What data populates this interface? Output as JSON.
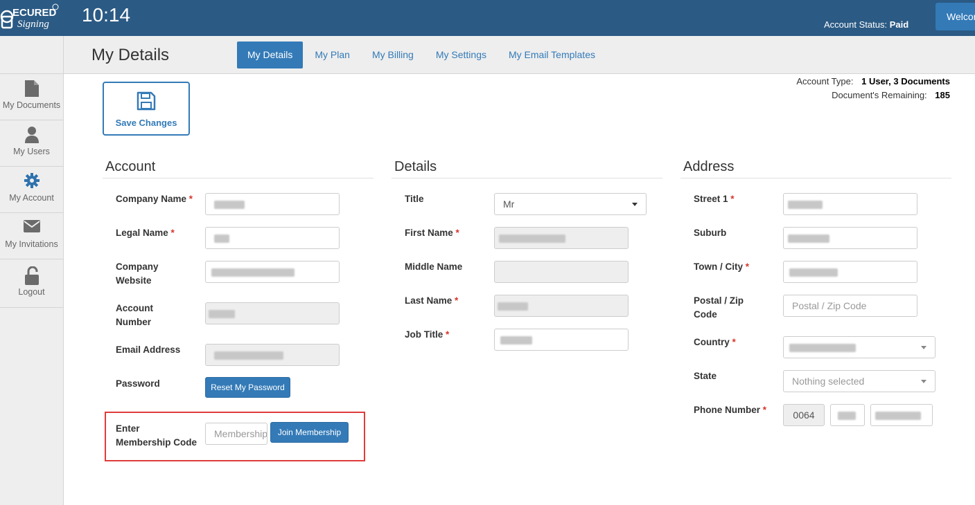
{
  "topbar": {
    "logo_text": "SECURED Signing",
    "clock": "10:14",
    "account_status_label": "Account Status:",
    "account_status_value": "Paid",
    "welcome_label": "Welcome"
  },
  "sidebar": {
    "items": [
      {
        "label": "My Documents",
        "icon": "document-icon"
      },
      {
        "label": "My Users",
        "icon": "user-icon"
      },
      {
        "label": "My Account",
        "icon": "gear-icon"
      },
      {
        "label": "My Invitations",
        "icon": "envelope-icon"
      },
      {
        "label": "Logout",
        "icon": "unlock-icon"
      }
    ]
  },
  "header": {
    "title": "My Details",
    "tabs": [
      {
        "label": "My Details",
        "active": true
      },
      {
        "label": "My Plan",
        "active": false
      },
      {
        "label": "My Billing",
        "active": false
      },
      {
        "label": "My Settings",
        "active": false
      },
      {
        "label": "My Email Templates",
        "active": false
      }
    ]
  },
  "account_info": {
    "type_label": "Account Type:",
    "type_value": "1 User, 3 Documents",
    "remaining_label": "Document's Remaining:",
    "remaining_value": "185"
  },
  "save_button": {
    "label": "Save Changes",
    "icon": "floppy-disk-icon"
  },
  "account": {
    "heading": "Account",
    "company_name_label": "Company Name",
    "legal_name_label": "Legal Name",
    "company_website_label_1": "Company",
    "company_website_label_2": "Website",
    "account_number_label_1": "Account",
    "account_number_label_2": "Number",
    "email_label": "Email Address",
    "password_label": "Password",
    "reset_password_button": "Reset My Password",
    "membership_label_1": "Enter",
    "membership_label_2": "Membership Code",
    "membership_placeholder": "Membership Code",
    "join_membership_button": "Join Membership",
    "required_mark": "*"
  },
  "details": {
    "heading": "Details",
    "title_label": "Title",
    "title_value": "Mr",
    "first_name_label": "First Name",
    "middle_name_label": "Middle Name",
    "last_name_label": "Last Name",
    "job_title_label": "Job Title"
  },
  "address": {
    "heading": "Address",
    "street_label": "Street 1",
    "suburb_label": "Suburb",
    "town_label": "Town / City",
    "postal_label_1": "Postal / Zip",
    "postal_label_2": "Code",
    "postal_placeholder": "Postal / Zip Code",
    "country_label": "Country",
    "state_label": "State",
    "state_value": "Nothing selected",
    "phone_label": "Phone Number",
    "phone_country_code": "0064"
  }
}
